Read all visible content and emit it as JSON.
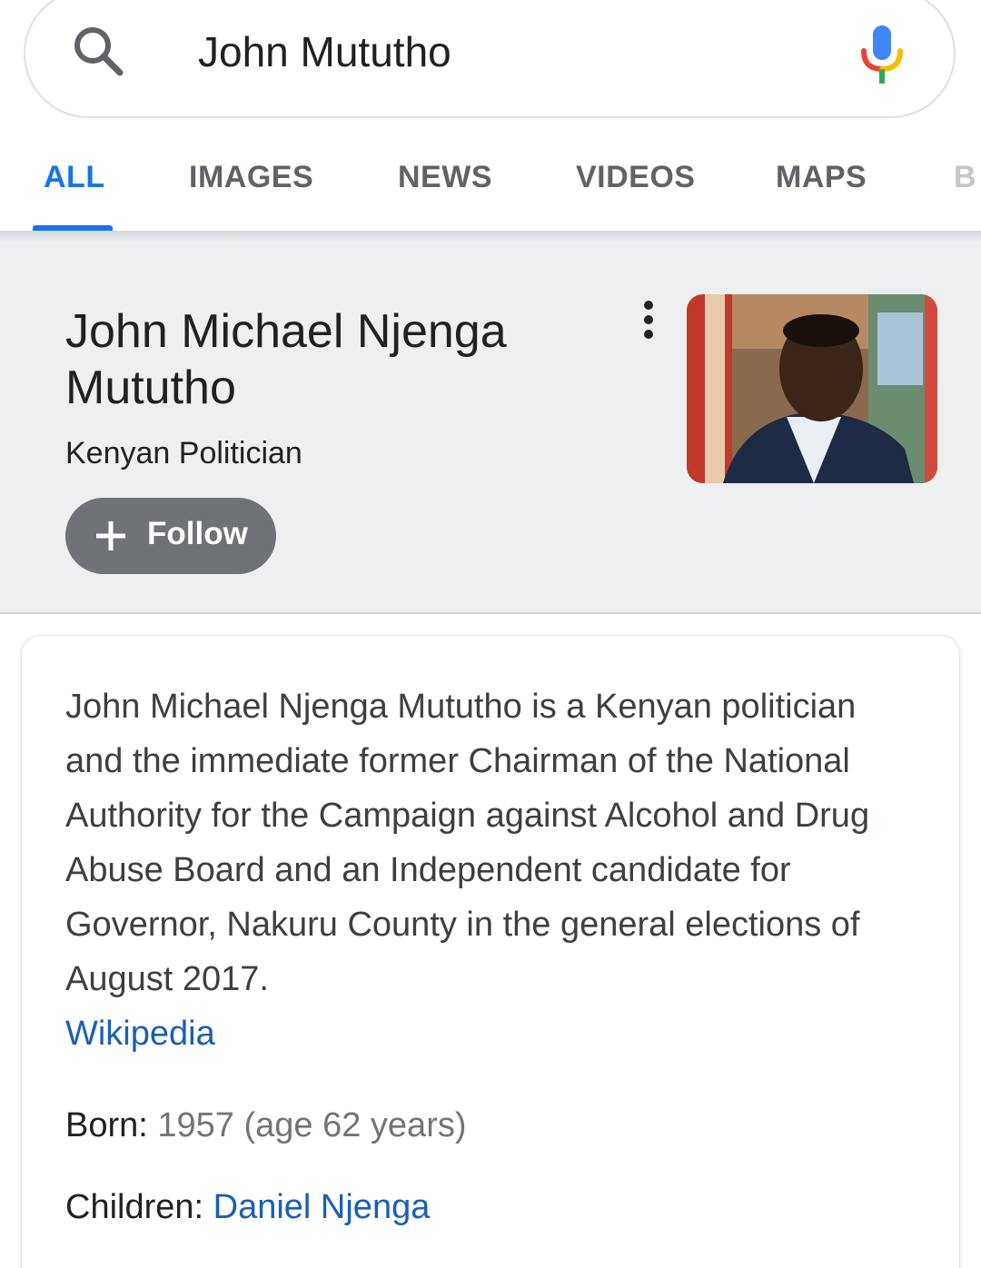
{
  "search": {
    "query": "John Mututho"
  },
  "tabs": [
    {
      "label": "ALL",
      "active": true
    },
    {
      "label": "IMAGES",
      "active": false
    },
    {
      "label": "NEWS",
      "active": false
    },
    {
      "label": "VIDEOS",
      "active": false
    },
    {
      "label": "MAPS",
      "active": false
    },
    {
      "label": "B",
      "active": false
    }
  ],
  "knowledge_panel": {
    "title": "John Michael Njenga Mututho",
    "subtitle": "Kenyan Politician",
    "follow_label": "Follow",
    "description": "John Michael Njenga Mututho is a Kenyan politician and the immediate former Chairman of the National Authority for the Campaign against Alcohol and Drug Abuse Board and an Independent candidate for Governor, Nakuru County in the general elections of August 2017.",
    "source_link": "Wikipedia",
    "facts": {
      "born_label": "Born:",
      "born_value": "1957 (age 62 years)",
      "children_label": "Children:",
      "children_value": "Daniel Njenga"
    }
  },
  "icons": {
    "search": "search-icon",
    "mic": "mic-icon",
    "more": "more-vert-icon",
    "follow": "plus-icon"
  },
  "colors": {
    "accent_blue": "#1a73e8",
    "link_blue": "#1a5fb4",
    "panel_bg": "#eeeff1",
    "follow_bg": "#6f7377",
    "mic_blue": "#4285f4",
    "mic_red": "#ea4335",
    "mic_yellow": "#fbbc05",
    "mic_green": "#34a853"
  }
}
